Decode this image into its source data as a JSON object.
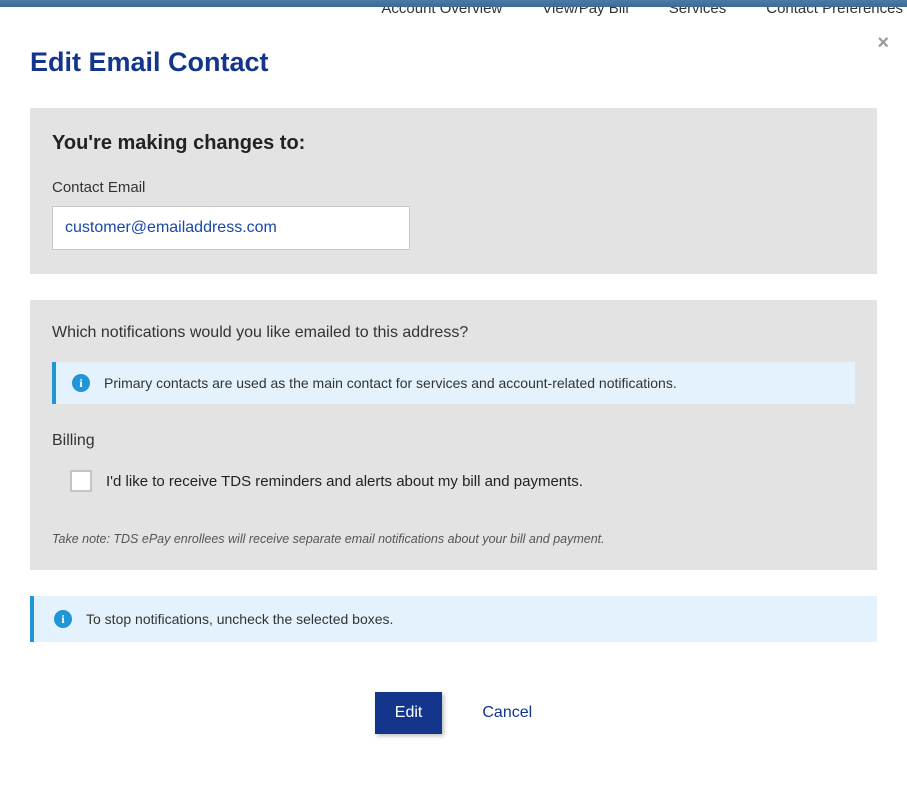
{
  "nav": {
    "items": [
      "Account Overview",
      "View/Pay Bill",
      "Services",
      "Contact Preferences"
    ]
  },
  "modal": {
    "title": "Edit Email Contact",
    "close_glyph": "×",
    "section1": {
      "heading": "You're making changes to:",
      "email_label": "Contact Email",
      "email_value": "customer@emailaddress.com"
    },
    "section2": {
      "prompt": "Which notifications would you like emailed to this address?",
      "info1": "Primary contacts are used as the main contact for services and account-related notifications.",
      "info_glyph": "i",
      "billing_heading": "Billing",
      "billing_checkbox_label": "I'd like to receive TDS reminders and alerts about my bill and payments.",
      "note": "Take note: TDS ePay enrollees will receive separate email notifications about your bill and payment."
    },
    "info2": "To stop notifications, uncheck the selected boxes.",
    "actions": {
      "edit": "Edit",
      "cancel": "Cancel"
    }
  }
}
